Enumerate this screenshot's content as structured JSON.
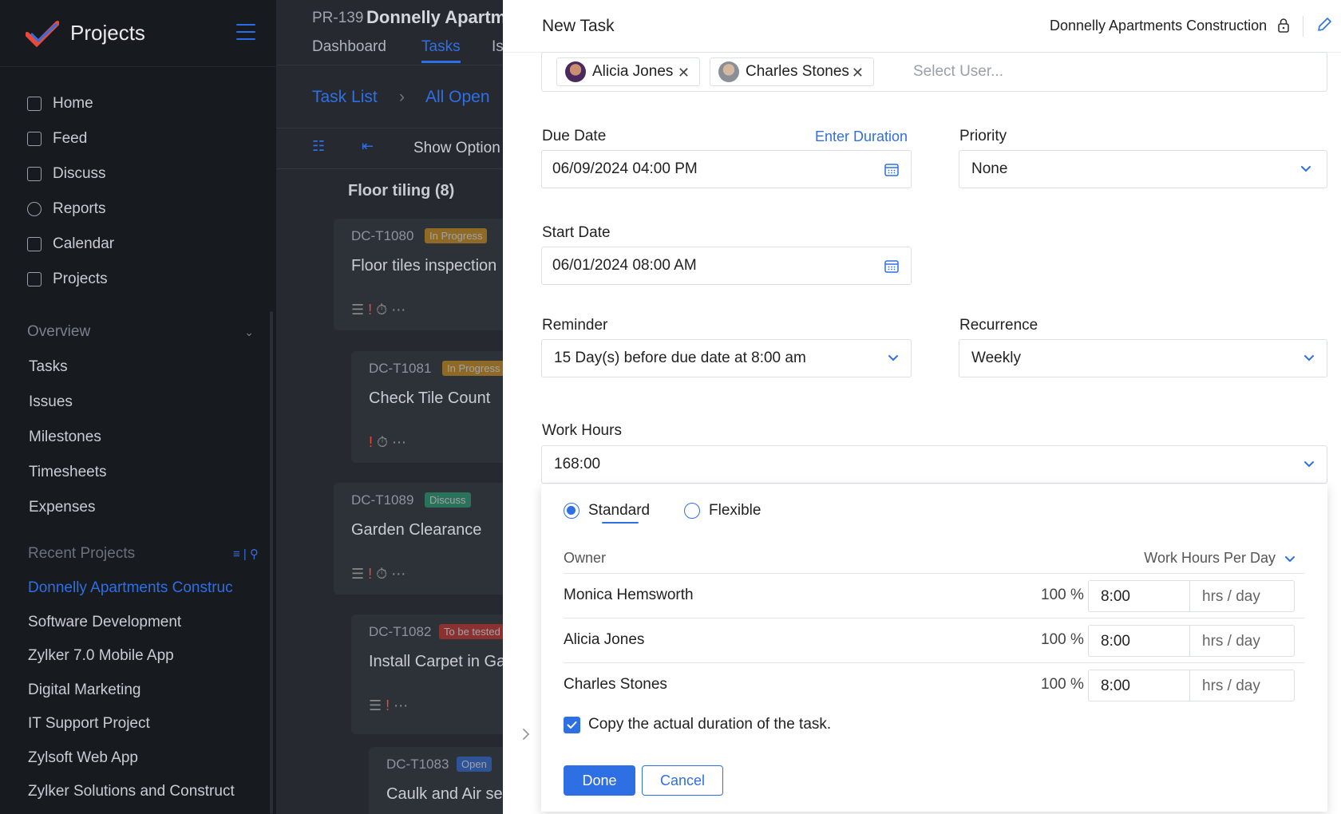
{
  "sidebar": {
    "app_title": "Projects",
    "nav": [
      "Home",
      "Feed",
      "Discuss",
      "Reports",
      "Calendar",
      "Projects"
    ],
    "overview_label": "Overview",
    "overview_items": [
      "Tasks",
      "Issues",
      "Milestones",
      "Timesheets",
      "Expenses"
    ],
    "recent_label": "Recent Projects",
    "recent": [
      "Donnelly Apartments Construc",
      "Software Development",
      "Zylker 7.0 Mobile App",
      "Digital Marketing",
      "IT Support Project",
      "Zylsoft Web App",
      "Zylker Solutions and Construct"
    ]
  },
  "project": {
    "id": "PR-139",
    "name": "Donnelly Apartm",
    "tabs": [
      "Dashboard",
      "Tasks",
      "Is"
    ],
    "crumb_list": "Task List",
    "crumb_filter": "All Open",
    "show_options": "Show Option",
    "group": "Floor tiling (8)",
    "cards": [
      {
        "id": "DC-T1080",
        "badge": "In Progress",
        "title": "Floor tiles inspection"
      },
      {
        "id": "DC-T1081",
        "badge": "In Progress",
        "title": "Check Tile Count"
      },
      {
        "id": "DC-T1089",
        "badge": "Discuss",
        "title": "Garden Clearance"
      },
      {
        "id": "DC-T1082",
        "badge": "To be tested",
        "title": "Install Carpet in Ga"
      },
      {
        "id": "DC-T1083",
        "badge": "Open",
        "title": "Caulk and Air sea"
      }
    ]
  },
  "panel": {
    "title": "New Task",
    "project_name": "Donnelly Apartments Construction",
    "users": [
      "Alicia Jones",
      "Charles Stones"
    ],
    "select_user_placeholder": "Select User...",
    "due_date_label": "Due Date",
    "enter_duration": "Enter Duration",
    "due_date_value": "06/09/2024 04:00 PM",
    "priority_label": "Priority",
    "priority_value": "None",
    "start_date_label": "Start Date",
    "start_date_value": "06/01/2024 08:00 AM",
    "reminder_label": "Reminder",
    "reminder_value": "15 Day(s) before due date at 8:00 am",
    "recurrence_label": "Recurrence",
    "recurrence_value": "Weekly",
    "work_hours_label": "Work Hours",
    "work_hours_value": "168:00"
  },
  "work_hours": {
    "mode_standard": "Standard",
    "mode_flexible": "Flexible",
    "owner_col": "Owner",
    "per_day_col": "Work Hours Per Day",
    "rows": [
      {
        "owner": "Monica Hemsworth",
        "pct": "100 %",
        "hours": "8:00",
        "unit": "hrs / day"
      },
      {
        "owner": "Alicia Jones",
        "pct": "100 %",
        "hours": "8:00",
        "unit": "hrs / day"
      },
      {
        "owner": "Charles Stones",
        "pct": "100 %",
        "hours": "8:00",
        "unit": "hrs / day"
      }
    ],
    "copy_label": "Copy the actual duration of the task.",
    "done": "Done",
    "cancel": "Cancel"
  },
  "colors": {
    "accent": "#2f6fe4",
    "sidebar_bg": "#171a1f"
  }
}
